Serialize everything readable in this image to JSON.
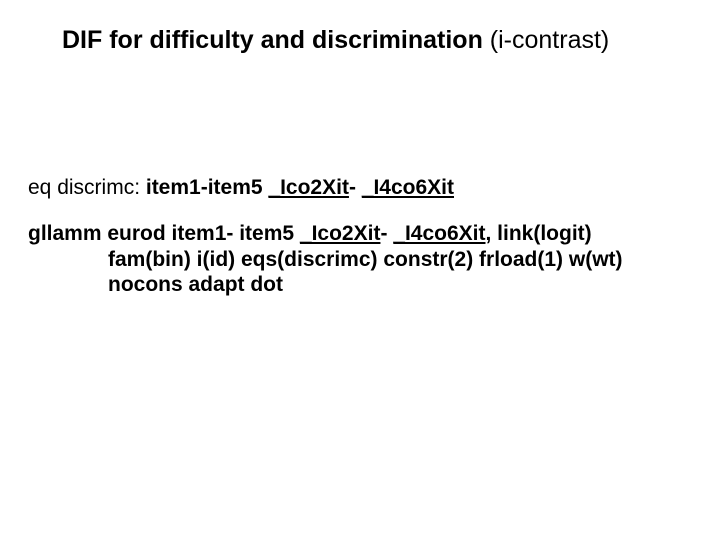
{
  "title": {
    "main": "DIF for difficulty and discrimination ",
    "paren": "(i-contrast)"
  },
  "eq": {
    "prefix": "eq discrimc: ",
    "bold1": "item1-item5 ",
    "under1": "_Ico2Xit",
    "mid1": "- ",
    "under2": "_I4co6Xit"
  },
  "code": {
    "l1a": "gllamm eurod   item1- item5  ",
    "l1u1": "_Ico2Xit",
    "l1m": "- ",
    "l1u2": "_I4co6Xit",
    "l1b": ", link(logit)",
    "l2": "fam(bin) i(id) eqs(discrimc) constr(2) frload(1) w(wt)",
    "l3": "nocons adapt dot"
  }
}
